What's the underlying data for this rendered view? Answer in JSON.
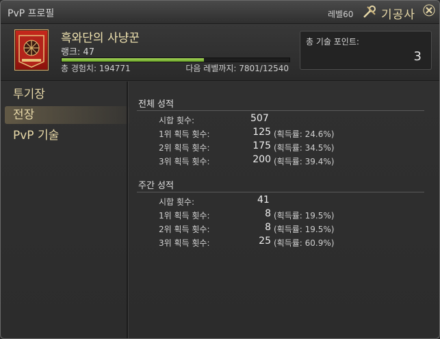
{
  "window": {
    "title": "PvP 프로필"
  },
  "header_bar": {
    "level_label": "레벨60",
    "job_name": "기공사",
    "job_icon": "machinist-wrench-icon",
    "close_icon": "close-icon"
  },
  "profile": {
    "title": "흑와단의 사냥꾼",
    "rank_label": "랭크: 47",
    "exp_progress": 0.6245,
    "exp_total_label": "총 경험치: 194771",
    "exp_next_label": "다음 레벨까지: 7801/12540",
    "emblem": "maelstrom-grand-company-emblem"
  },
  "skill_points": {
    "label": "총 기술 포인트:",
    "value": "3"
  },
  "menu": {
    "items": [
      {
        "label": "투기장"
      },
      {
        "label": "전장"
      },
      {
        "label": "PvP 기술"
      }
    ],
    "active_index": 1
  },
  "overall": {
    "title": "전체 성적",
    "rows": [
      {
        "label": "시합 횟수:",
        "value": "507",
        "rate": ""
      },
      {
        "label": "1위 획득 횟수:",
        "value": "125",
        "rate": "(획득률: 24.6%)"
      },
      {
        "label": "2위 획득 횟수:",
        "value": "175",
        "rate": "(획득률: 34.5%)"
      },
      {
        "label": "3위 획득 횟수:",
        "value": "200",
        "rate": "(획득률: 39.4%)"
      }
    ]
  },
  "weekly": {
    "title": "주간 성적",
    "rows": [
      {
        "label": "시합 횟수:",
        "value": "41",
        "rate": ""
      },
      {
        "label": "1위 획득 횟수:",
        "value": "8",
        "rate": "(획득률: 19.5%)"
      },
      {
        "label": "2위 획득 횟수:",
        "value": "8",
        "rate": "(획득률: 19.5%)"
      },
      {
        "label": "3위 획득 횟수:",
        "value": "25",
        "rate": "(획득률: 60.9%)"
      }
    ]
  },
  "colors": {
    "accent_gold": "#e8d9a8",
    "exp_bar": "#8cc63f",
    "emblem_red": "#b3231a"
  }
}
